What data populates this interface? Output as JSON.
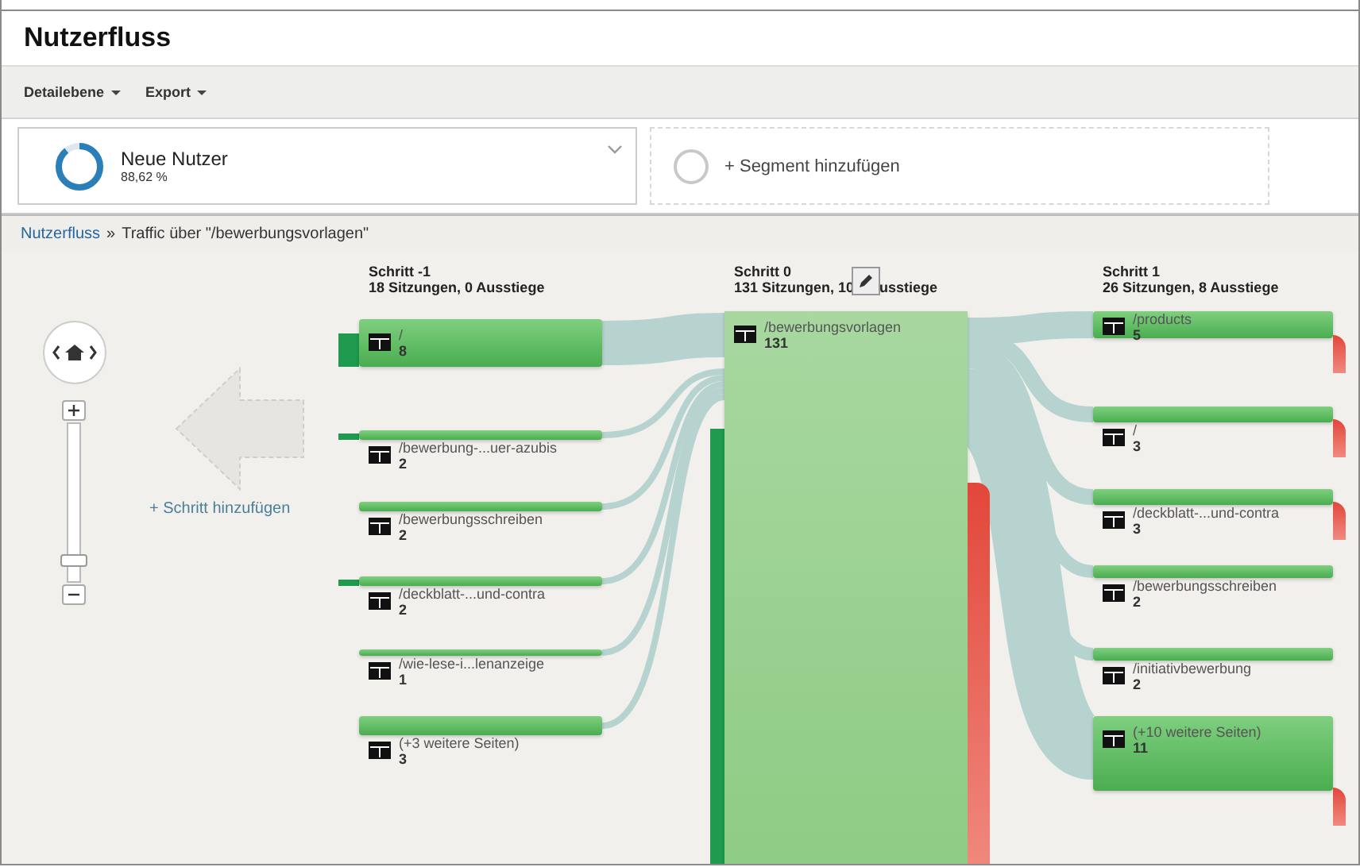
{
  "title": "Nutzerfluss",
  "toolbar": [
    {
      "label": "Detailebene"
    },
    {
      "label": "Export"
    }
  ],
  "segments": {
    "active": {
      "name": "Neue Nutzer",
      "share": "88,62 %",
      "level": 0.8862
    },
    "add": {
      "label": "+ Segment hinzufügen"
    }
  },
  "breadcrumb": {
    "link": "Nutzerfluss",
    "separator": "»",
    "text": "Traffic über \"/bewerbungsvorlagen\""
  },
  "zoom": {
    "level": 0.1
  },
  "add_step": "+ Schritt hinzufügen",
  "columns": [
    {
      "title": "Schritt -1",
      "subtitle": "18 Sitzungen, 0 Ausstiege",
      "nodes": [
        {
          "path": "/",
          "count": "8",
          "entries": true,
          "exits": false
        },
        {
          "path": "/bewerbung-...uer-azubis",
          "count": "2",
          "entries": true,
          "exits": false
        },
        {
          "path": "/bewerbungsschreiben",
          "count": "2",
          "entries": false,
          "exits": false
        },
        {
          "path": "/deckblatt-...und-contra",
          "count": "2",
          "entries": true,
          "exits": false
        },
        {
          "path": "/wie-lese-i...lenanzeige",
          "count": "1",
          "entries": false,
          "exits": false
        },
        {
          "path": "(+3 weitere Seiten)",
          "count": "3",
          "entries": false,
          "exits": false
        }
      ]
    },
    {
      "title": "Schritt 0",
      "subtitle": "131 Sitzungen, 10",
      "subtitle_rest": "usstiege",
      "nodes": [
        {
          "path": "/bewerbungsvorlagen",
          "count": "131",
          "entries": true,
          "exits": true
        }
      ]
    },
    {
      "title": "Schritt 1",
      "subtitle": "26 Sitzungen, 8 Ausstiege",
      "nodes": [
        {
          "path": "/products",
          "count": "5",
          "entries": false,
          "exits": true
        },
        {
          "path": "/",
          "count": "3",
          "entries": false,
          "exits": true
        },
        {
          "path": "/deckblatt-...und-contra",
          "count": "3",
          "entries": false,
          "exits": true
        },
        {
          "path": "/bewerbungsschreiben",
          "count": "2",
          "entries": false,
          "exits": false
        },
        {
          "path": "/initiativbewerbung",
          "count": "2",
          "entries": false,
          "exits": false
        },
        {
          "path": "(+10 weitere Seiten)",
          "count": "11",
          "entries": false,
          "exits": true
        }
      ]
    }
  ]
}
